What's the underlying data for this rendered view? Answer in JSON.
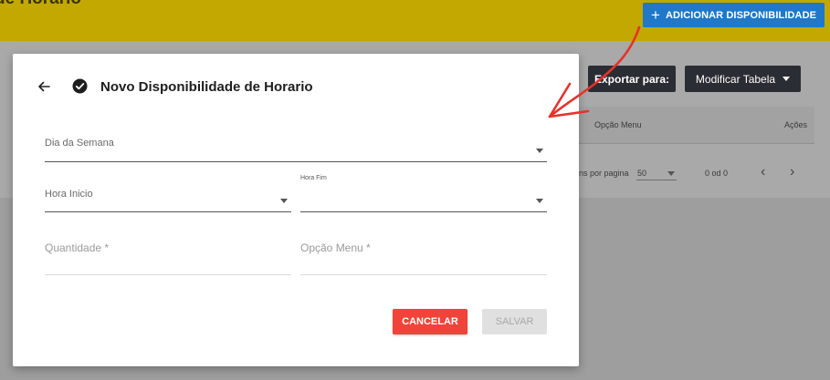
{
  "background": {
    "page_title": "de Horario",
    "add_button_label": "ADICIONAR DISPONIBILIDADE",
    "export_button_label": "Exportar para:",
    "modify_table_label": "Modificar Tabela",
    "table_headers": [
      "Opção Menu",
      "Ações"
    ],
    "pager": {
      "rows_per_page_label": "ns por pagina",
      "rows_per_page_value": "50",
      "range": "0 od 0"
    }
  },
  "modal": {
    "title": "Novo Disponibilidade de Horario",
    "fields": {
      "dia_semana": {
        "label": "Dia da Semana"
      },
      "hora_inicio": {
        "label": "Hora Inicio"
      },
      "hora_fim": {
        "label": "Hora Fim"
      },
      "quantidade": {
        "label": "Quantidade *"
      },
      "opcao_menu": {
        "label": "Opção Menu *"
      }
    },
    "cancel_label": "CANCELAR",
    "save_label": "SALVAR"
  },
  "colors": {
    "topbar": "#c2a800",
    "primary_blue": "#1f78c8",
    "dark_button": "#2a2d33",
    "cancel_red": "#f0443a",
    "annotation_red": "#e5322c"
  },
  "icons": [
    "plus-icon",
    "back-arrow-icon",
    "check-circle-icon",
    "chevron-down-icon",
    "chevron-left-icon",
    "chevron-right-icon"
  ]
}
